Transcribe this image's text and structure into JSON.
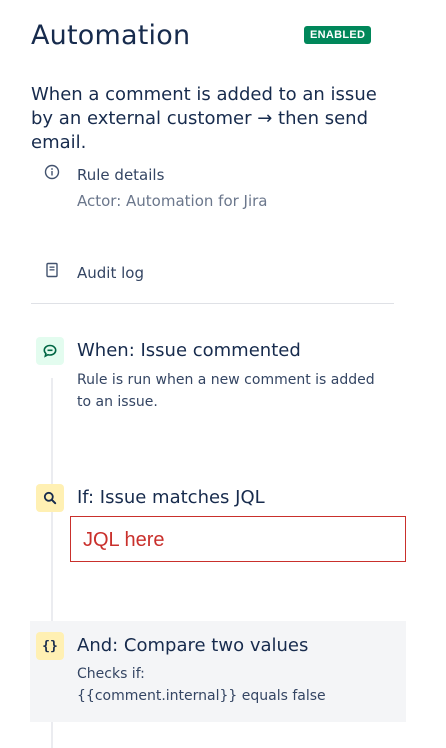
{
  "header": {
    "title": "Automation",
    "status_badge": "ENABLED"
  },
  "rule": {
    "description": "When a comment is added to an issue by an external customer → then send email.",
    "details_label": "Rule details",
    "actor": "Actor: Automation for Jira",
    "audit_log_label": "Audit log"
  },
  "steps": [
    {
      "icon": "comment-icon",
      "title": "When: Issue commented",
      "description": "Rule is run when a new comment is added to an issue."
    },
    {
      "icon": "search-icon",
      "title": "If: Issue matches JQL",
      "jql_value": "JQL here"
    },
    {
      "icon": "braces-icon",
      "icon_glyph": "{}",
      "title": "And: Compare two values",
      "description_line1": "Checks if:",
      "description_line2": "{{comment.internal}} equals false"
    }
  ],
  "colors": {
    "badge": "#00875a",
    "trigger_icon_bg": "#e3fcef",
    "condition_icon_bg": "#fff0b3",
    "jql_box_border": "#c9302c"
  }
}
